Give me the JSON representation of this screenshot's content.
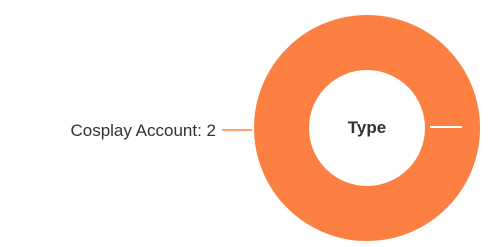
{
  "chart_data": {
    "type": "pie",
    "variant": "donut",
    "center_label": "Type",
    "slices": [
      {
        "label": "Cosplay Account",
        "value": 2,
        "color": "#fd8043"
      }
    ],
    "label_format": "{label}: {value}",
    "legend": "none",
    "grid": false
  }
}
